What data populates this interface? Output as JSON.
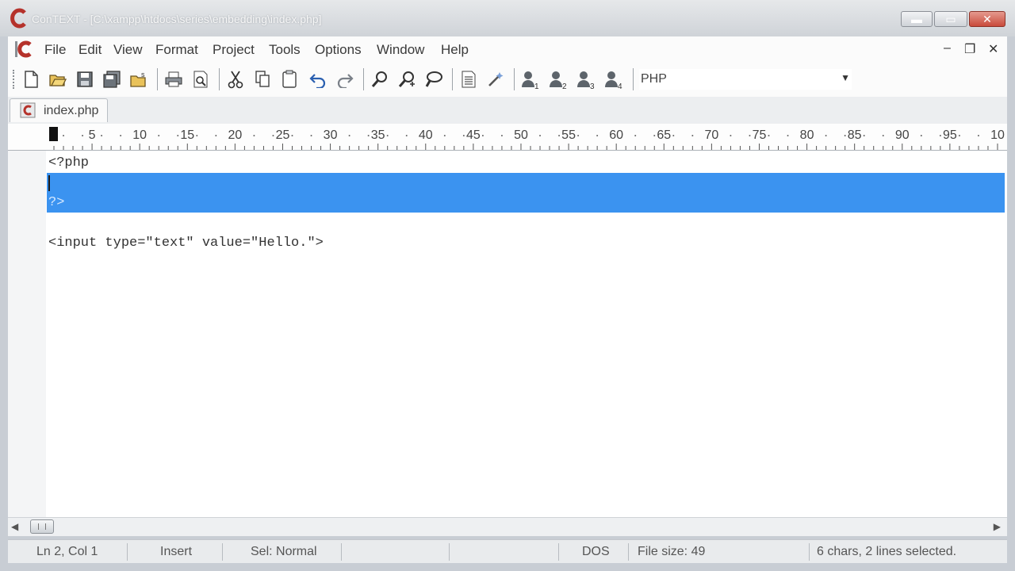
{
  "window": {
    "title": "ConTEXT - [C:\\xampp\\htdocs\\series\\embedding\\index.php]",
    "minimize_glyph": "▬",
    "maximize_glyph": "▭",
    "close_glyph": "✕"
  },
  "menu": {
    "items": [
      "File",
      "Edit",
      "View",
      "Format",
      "Project",
      "Tools",
      "Options",
      "Window",
      "Help"
    ],
    "mdi_minimize": "–",
    "mdi_restore": "❐",
    "mdi_close": "✕"
  },
  "toolbar": {
    "language": "PHP",
    "macro_labels": [
      "1",
      "2",
      "3",
      "4"
    ]
  },
  "tabs": [
    {
      "label": "index.php",
      "active": true
    }
  ],
  "ruler": {
    "labels": [
      "5",
      "10",
      "15",
      "20",
      "25",
      "30",
      "35",
      "40",
      "45",
      "50",
      "55",
      "60",
      "65",
      "70",
      "75",
      "80",
      "85",
      "90",
      "95",
      "10"
    ]
  },
  "editor": {
    "lines": [
      "<?php",
      "",
      "?>",
      "",
      "<input type=\"text\" value=\"Hello.\">"
    ]
  },
  "statusbar": {
    "position": "Ln 2, Col 1",
    "mode": "Insert",
    "sel_mode": "Sel: Normal",
    "line_ending": "DOS",
    "file_size": "File size: 49",
    "selection_info": "6 chars, 2 lines selected."
  },
  "colors": {
    "selection": "#3b93f0",
    "close_button": "#c94b3b",
    "app_icon": "#b5322b"
  }
}
